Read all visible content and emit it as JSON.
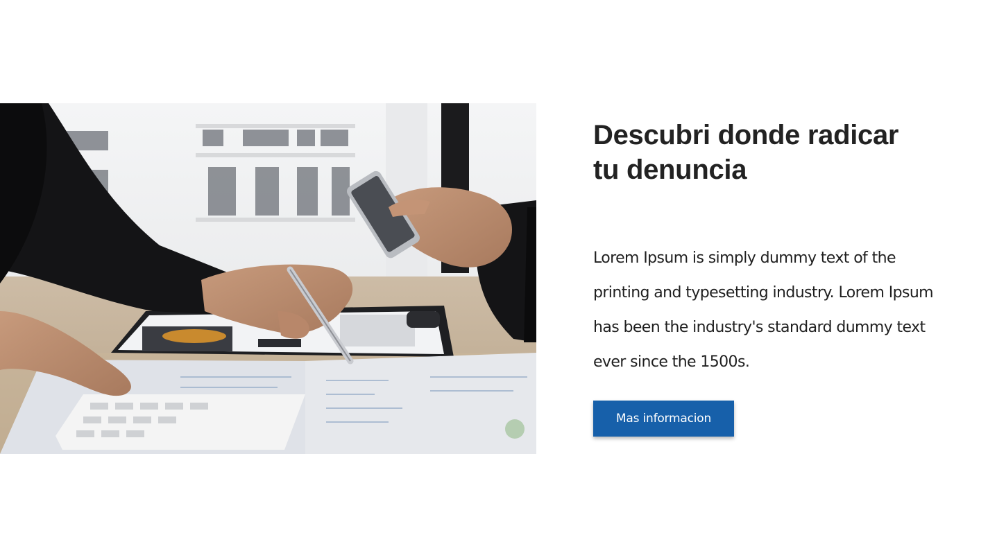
{
  "feature": {
    "image_alt": "Business people reviewing financial documents with a pen, calculator and smartphone",
    "title_line1": "Descubri donde radicar",
    "title_line2": "tu denuncia",
    "description": "Lorem Ipsum is simply dummy text of the printing and typesetting industry. Lorem Ipsum has been the industry's standard dummy text ever since the 1500s.",
    "button_label": "Mas informacion"
  },
  "colors": {
    "button_bg": "#1760aa",
    "button_text": "#ffffff",
    "title_text": "#222222",
    "body_text": "#1f1f1f"
  }
}
